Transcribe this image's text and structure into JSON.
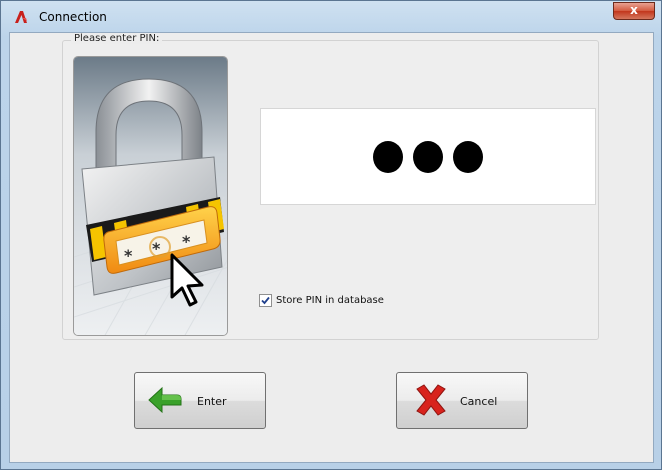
{
  "window": {
    "title": "Connection",
    "close_glyph": "x"
  },
  "group": {
    "label": "Please enter PIN:"
  },
  "pin": {
    "masked_length": 3
  },
  "store_pin": {
    "label": "Store PIN in database",
    "checked": true
  },
  "buttons": {
    "enter": {
      "label": "Enter",
      "icon": "green-arrow-left-icon"
    },
    "cancel": {
      "label": "Cancel",
      "icon": "red-x-icon"
    }
  },
  "images": {
    "lock": "padlock-pin-keypad-illustration"
  }
}
